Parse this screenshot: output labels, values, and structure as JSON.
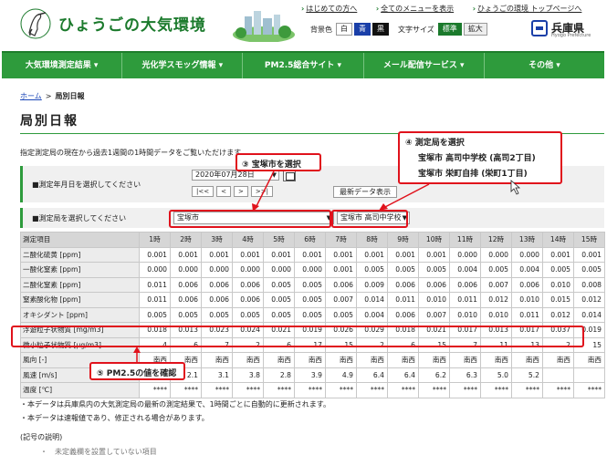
{
  "header": {
    "site_title": "ひょうごの大気環境",
    "links": [
      "はじめての方へ",
      "全てのメニューを表示",
      "ひょうごの環境 トップページへ"
    ],
    "bg_label": "背景色",
    "bg_options": [
      "白",
      "青",
      "黒"
    ],
    "font_label": "文字サイズ",
    "font_options": [
      "標準",
      "拡大"
    ],
    "pref_name": "兵庫県",
    "pref_sub": "Hyogo Prefecture"
  },
  "nav": [
    "大気環境測定結果 ▾",
    "光化学スモッグ情報 ▾",
    "PM2.5総合サイト ▾",
    "メール配信サービス ▾",
    "その他 ▾"
  ],
  "breadcrumb": {
    "home": "ホーム",
    "separator": ">",
    "current": "局別日報"
  },
  "page_title": "局別日報",
  "intro": "指定測定局の現在から過去1週間の1時間データをご覧いただけます。",
  "date_row": {
    "label": "■測定年月日を選択してください",
    "date_value": "2020年07月28日",
    "nav_buttons": [
      "|<<",
      "<",
      ">",
      ">>|"
    ],
    "latest_button": "最新データ表示"
  },
  "station_row": {
    "label": "■測定局を選択してください",
    "city_value": "宝塚市",
    "station_value": "宝塚市 高司中学校"
  },
  "table": {
    "header_first": "測定項目",
    "hours": [
      "1時",
      "2時",
      "3時",
      "4時",
      "5時",
      "6時",
      "7時",
      "8時",
      "9時",
      "10時",
      "11時",
      "12時",
      "13時",
      "14時",
      "15時"
    ],
    "rows": [
      {
        "name": "二酸化硫黄 [ppm]",
        "values": [
          "0.001",
          "0.001",
          "0.001",
          "0.001",
          "0.001",
          "0.001",
          "0.001",
          "0.001",
          "0.001",
          "0.001",
          "0.000",
          "0.000",
          "0.000",
          "0.001",
          "0.001"
        ]
      },
      {
        "name": "一酸化窒素 [ppm]",
        "values": [
          "0.000",
          "0.000",
          "0.000",
          "0.000",
          "0.000",
          "0.000",
          "0.001",
          "0.005",
          "0.005",
          "0.005",
          "0.004",
          "0.005",
          "0.004",
          "0.005",
          "0.005"
        ]
      },
      {
        "name": "二酸化窒素 [ppm]",
        "values": [
          "0.011",
          "0.006",
          "0.006",
          "0.006",
          "0.005",
          "0.005",
          "0.006",
          "0.009",
          "0.006",
          "0.006",
          "0.006",
          "0.007",
          "0.006",
          "0.010",
          "0.008"
        ]
      },
      {
        "name": "窒素酸化物 [ppm]",
        "values": [
          "0.011",
          "0.006",
          "0.006",
          "0.006",
          "0.005",
          "0.005",
          "0.007",
          "0.014",
          "0.011",
          "0.010",
          "0.011",
          "0.012",
          "0.010",
          "0.015",
          "0.012"
        ]
      },
      {
        "name": "オキシダント [ppm]",
        "values": [
          "0.005",
          "0.005",
          "0.005",
          "0.005",
          "0.005",
          "0.005",
          "0.005",
          "0.004",
          "0.006",
          "0.007",
          "0.010",
          "0.010",
          "0.011",
          "0.012",
          "0.014"
        ]
      },
      {
        "name": "浮遊粒子状物質 [mg/m3]",
        "values": [
          "0.018",
          "0.013",
          "0.023",
          "0.024",
          "0.021",
          "0.019",
          "0.026",
          "0.029",
          "0.018",
          "0.021",
          "0.017",
          "0.013",
          "0.017",
          "0.037",
          "0.019"
        ]
      },
      {
        "name": "微小粒子状物質 [μg/m3]",
        "values": [
          "4",
          "6",
          "7",
          "2",
          "6",
          "17",
          "15",
          "2",
          "6",
          "15",
          "7",
          "11",
          "13",
          "2",
          "15"
        ]
      },
      {
        "name": "風向 [-]",
        "values": [
          "南西",
          "南西",
          "南西",
          "南西",
          "南西",
          "南西",
          "南西",
          "南西",
          "南西",
          "南西",
          "南西",
          "南西",
          "南西",
          "南西",
          "南西"
        ]
      },
      {
        "name": "風速 [m/s]",
        "values": [
          "2.0",
          "2.1",
          "3.1",
          "3.8",
          "2.8",
          "3.9",
          "4.9",
          "6.4",
          "6.4",
          "6.2",
          "6.3",
          "5.0",
          "5.2",
          "",
          ""
        ]
      },
      {
        "name": "温度 [℃]",
        "values": [
          "****",
          "****",
          "****",
          "****",
          "****",
          "****",
          "****",
          "****",
          "****",
          "****",
          "****",
          "****",
          "****",
          "****",
          "****"
        ]
      }
    ]
  },
  "annotations": {
    "step3": "③ 宝塚市を選択",
    "step4_title": "④ 測定局を選択",
    "step4_line1": "宝塚市 高司中学校 (高司2丁目)",
    "step4_line2": "宝塚市 栄町自排 (栄町1丁目)",
    "step5": "⑤ PM2.5の値を確認"
  },
  "notes": [
    "・本データは兵庫県内の大気測定局の最新の測定結果で、1時間ごとに自動的に更新されます。",
    "・本データは速報値であり、修正される場合があります。"
  ],
  "legend_title": "(記号の説明)",
  "legend_item": "・　未定義欄を設置していない項目",
  "colors": {
    "brand_green": "#2e9b3c",
    "highlight_red": "#e0121c"
  }
}
